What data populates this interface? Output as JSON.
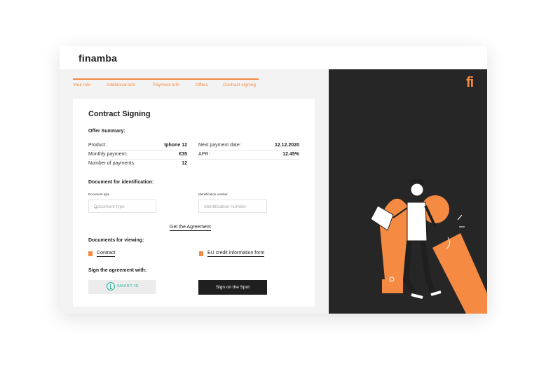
{
  "app": {
    "logo": "finamba",
    "brand_mark": "fi",
    "accent_color": "#f58a42"
  },
  "steps": [
    "Your info",
    "Additional info",
    "Payment info",
    "Offers",
    "Contract signing"
  ],
  "card": {
    "title": "Contract Signing",
    "offer_summary_heading": "Offer Summary:",
    "summary_left": [
      {
        "label": "Product:",
        "value": "Iphone 12"
      },
      {
        "label": "Monthly payment:",
        "value": "€35"
      },
      {
        "label": "Number of payments:",
        "value": "12"
      }
    ],
    "summary_right": [
      {
        "label": "Next payment date:",
        "value": "12.12.2020"
      },
      {
        "label": "APR:",
        "value": "12.45%"
      }
    ],
    "identification": {
      "heading": "Document for identification:",
      "doc_type_label": "Document type",
      "doc_type_placeholder": "Document type",
      "id_number_label": "Identification number",
      "id_number_placeholder": "Identification number"
    },
    "get_agreement": "Get the Agreement",
    "viewing": {
      "heading": "Documents for viewing:",
      "docs": [
        "Contract",
        "EU credit information form"
      ]
    },
    "sign": {
      "heading": "Sign the agreement with:",
      "smart_id_label": "SMART-ID",
      "sign_spot_label": "Sign on the Spot"
    }
  }
}
